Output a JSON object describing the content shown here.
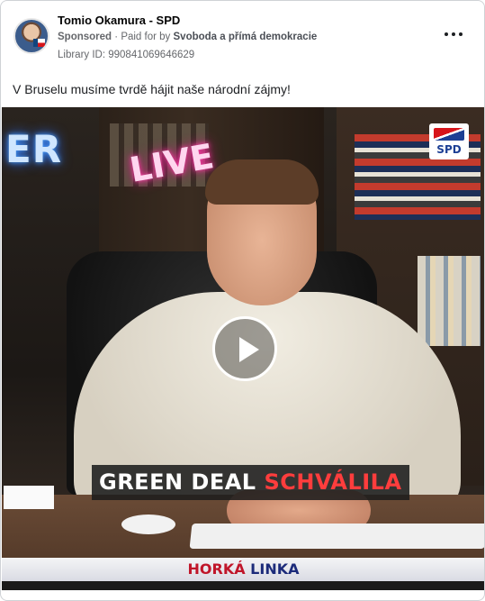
{
  "post": {
    "page_name": "Tomio Okamura - SPD",
    "sponsored_label": "Sponsored",
    "separator": "·",
    "paid_for_prefix": "Paid for by",
    "payer": "Svoboda a přímá demokracie",
    "library_id": "Library ID: 990841069646629",
    "caption": "V Bruselu musíme tvrdě hájit naše národní zájmy!",
    "options_icon": "more-horizontal-icon"
  },
  "video": {
    "neon_sign_left": "ER",
    "neon_sign_live": "LIVE",
    "party_logo_text": "SPD",
    "lower_third_white": "GREEN DEAL",
    "lower_third_red": "SCHVÁLILA",
    "show_name_part1": "HORKÁ",
    "show_name_part2": "LINKA",
    "play_icon": "play-icon"
  },
  "colors": {
    "accent_red": "#ff3d3d",
    "show_red": "#c0162a",
    "show_blue": "#1c2b7a",
    "meta_gray": "#65676b"
  }
}
